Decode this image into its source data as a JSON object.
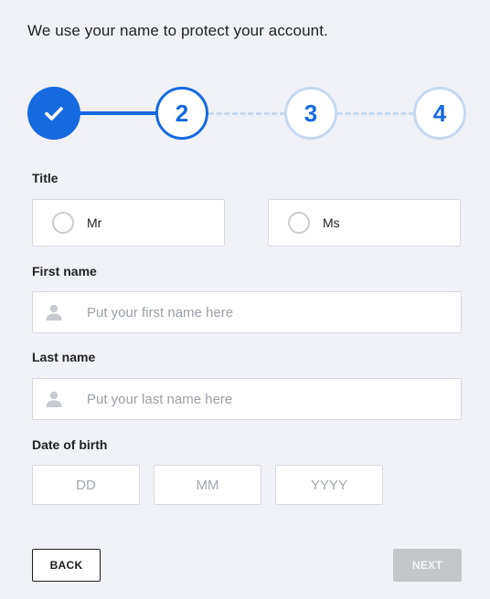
{
  "intro": "We use your name to protect your account.",
  "stepper": {
    "steps": [
      {
        "label": "",
        "state": "completed"
      },
      {
        "label": "2",
        "state": "active"
      },
      {
        "label": "3",
        "state": "upcoming"
      },
      {
        "label": "4",
        "state": "upcoming"
      }
    ],
    "colors": {
      "active": "#1769e0",
      "upcoming": "#c6d9f1"
    }
  },
  "title_field": {
    "label": "Title",
    "options": [
      "Mr",
      "Ms"
    ]
  },
  "first_name": {
    "label": "First name",
    "placeholder": "Put your first name here"
  },
  "last_name": {
    "label": "Last name",
    "placeholder": "Put your last name here"
  },
  "dob": {
    "label": "Date of birth",
    "day_placeholder": "DD",
    "month_placeholder": "MM",
    "year_placeholder": "YYYY"
  },
  "buttons": {
    "back": "BACK",
    "next": "NEXT"
  }
}
